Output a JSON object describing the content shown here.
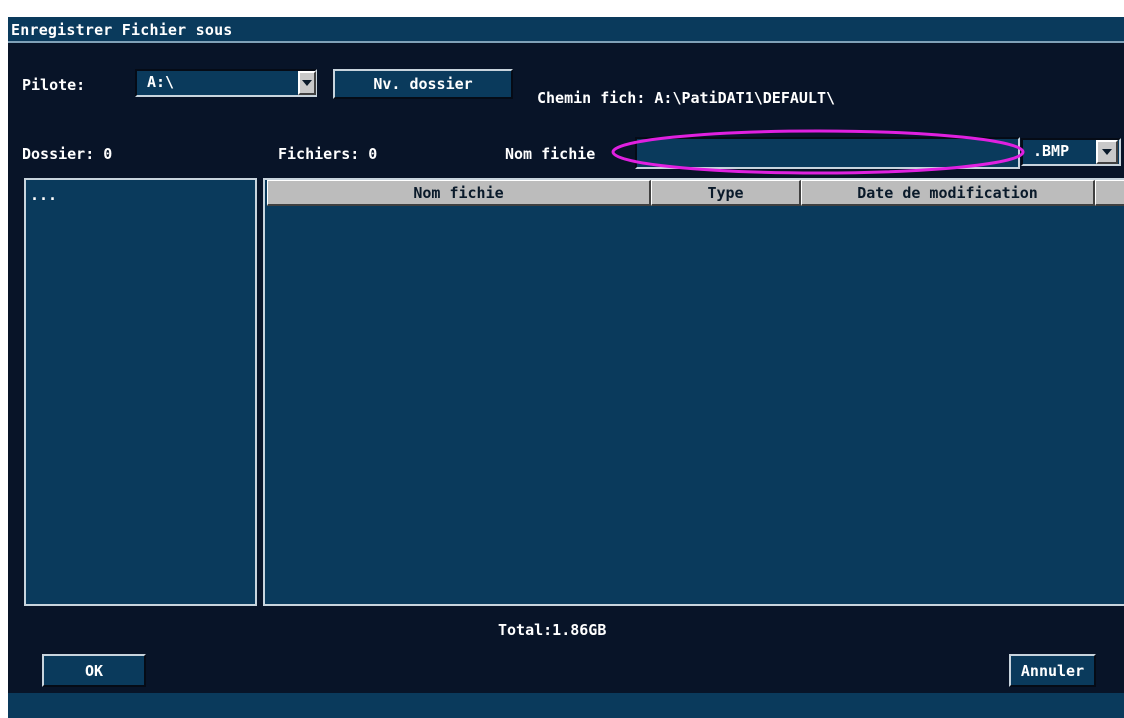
{
  "dialog": {
    "title": "Enregistrer Fichier sous"
  },
  "drive": {
    "label": "Pilote:",
    "value": "A:\\"
  },
  "new_folder_button": "Nv. dossier",
  "path": {
    "text": "Chemin fich: A:\\PatiDAT1\\DEFAULT\\"
  },
  "counts": {
    "folders": "Dossier: 0",
    "files": "Fichiers: 0"
  },
  "filename": {
    "label": "Nom fichie",
    "value": ""
  },
  "file_type": {
    "value": ".BMP"
  },
  "folder_list": {
    "items": [
      "..."
    ]
  },
  "file_table": {
    "columns": [
      "Nom fichie",
      "Type",
      "Date de modification"
    ],
    "rows": []
  },
  "total": "Total:1.86GB",
  "buttons": {
    "ok": "OK",
    "cancel": "Annuler"
  },
  "colors": {
    "background": "#081428",
    "panel": "#0a3a5c",
    "header": "#bcbcbc",
    "highlight_ellipse": "#e020e0"
  }
}
